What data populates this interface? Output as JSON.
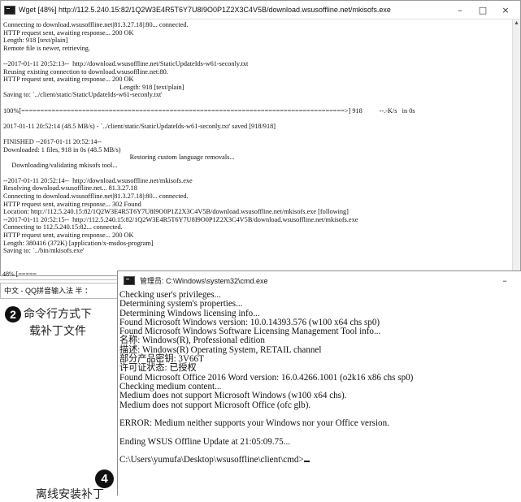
{
  "wget_window": {
    "title": "Wget [48%] http://112.5.240.15:82/1Q2W3E4R5T6Y7U8I9O0P1Z2X3C4V5B/download.wsusoffline.net/mkisofs.exe",
    "icon": "console-icon",
    "controls": [
      "–",
      "□",
      "×"
    ],
    "lines": [
      "Connecting to download.wsusoffline.net|81.3.27.18|:80... connected.",
      "HTTP request sent, awaiting response... 200 OK",
      "Length: 918 [text/plain]",
      "Remote file is newer, retrieving.",
      "",
      "--2017-01-11 20:52:13--  http://download.wsusoffline.net/StaticUpdateIds-w61-seconly.txt",
      "Reusing existing connection to download.wsusoffline.net:80.",
      "HTTP request sent, awaiting response... 200 OK",
      "                                                                     Length: 918 [text/plain]",
      "Saving to: `../client/static/StaticUpdateIds-w61-seconly.txt'",
      "",
      "100%[=====================================================================================>] 918          --.-K/s   in 0s",
      "",
      "2017-01-11 20:52:14 (48.5 MB/s) - `../client/static/StaticUpdateIds-w61-seconly.txt' saved [918/918]",
      "",
      "FINISHED --2017-01-11 20:52:14--",
      "Downloaded: 1 files, 918 in 0s (48.5 MB/s)",
      "                                                                           Restoring custom language removals...",
      "     Downloading/validating mkisofs tool...",
      "",
      "--2017-01-11 20:52:14--  http://download.wsusoffline.net/mkisofs.exe",
      "Resolving download.wsusoffline.net... 81.3.27.18",
      "Connecting to download.wsusoffline.net|81.3.27.18|:80... connected.",
      "HTTP request sent, awaiting response... 302 Found",
      "Location: http://112.5.240.15:82/1Q2W3E4R5T6Y7U8I9O0P1Z2X3C4V5B/download.wsusoffline.net/mkisofs.exe [following]",
      "--2017-01-11 20:52:15--  http://112.5.240.15:82/1Q2W3E4R5T6Y7U8I9O0P1Z2X3C4V5B/download.wsusoffline.net/mkisofs.exe",
      "Connecting to 112.5.240.15:82... connected.",
      "HTTP request sent, awaiting response... 200 OK",
      "Length: 380416 (372K) [application/x-msdos-program]",
      "Saving to: `../bin/mkisofs.exe'"
    ],
    "progress_fragment": "48% [=====",
    "progress_percent": 48
  },
  "ime_bar": {
    "text": "中文 - QQ拼音输入法 半 ："
  },
  "annotations": {
    "step2": {
      "number": "2",
      "line1": "命令行方式下",
      "line2": "载补丁文件"
    },
    "step4": {
      "number": "4",
      "text": "离线安装补丁"
    }
  },
  "cmd_window": {
    "title": "管理员: C:\\Windows\\system32\\cmd.exe",
    "icon": "console-icon",
    "minimize": "–",
    "lines": [
      "Checking user's privileges...",
      "Determining system's properties...",
      "Determining Windows licensing info...",
      "Found Microsoft Windows version: 10.0.14393.576 (w100 x64 chs sp0)",
      "Found Microsoft Windows Software Licensing Management Tool info...",
      "名称: Windows(R), Professional edition",
      "描述: Windows(R) Operating System, RETAIL channel",
      "部分产品密钥: 3V66T",
      "许可证状态: 已授权",
      "Found Microsoft Office 2016 Word version: 16.0.4266.1001 (o2k16 x86 chs sp0)",
      "Checking medium content...",
      "Medium does not support Microsoft Windows (w100 x64 chs).",
      "Medium does not support Microsoft Office (ofc glb).",
      "",
      "ERROR: Medium neither supports your Windows nor your Office version.",
      "",
      "Ending WSUS Offline Update at 21:05:09.75...",
      ""
    ],
    "prompt": "C:\\Users\\yumufa\\Desktop\\wsusoffline\\client\\cmd>"
  }
}
